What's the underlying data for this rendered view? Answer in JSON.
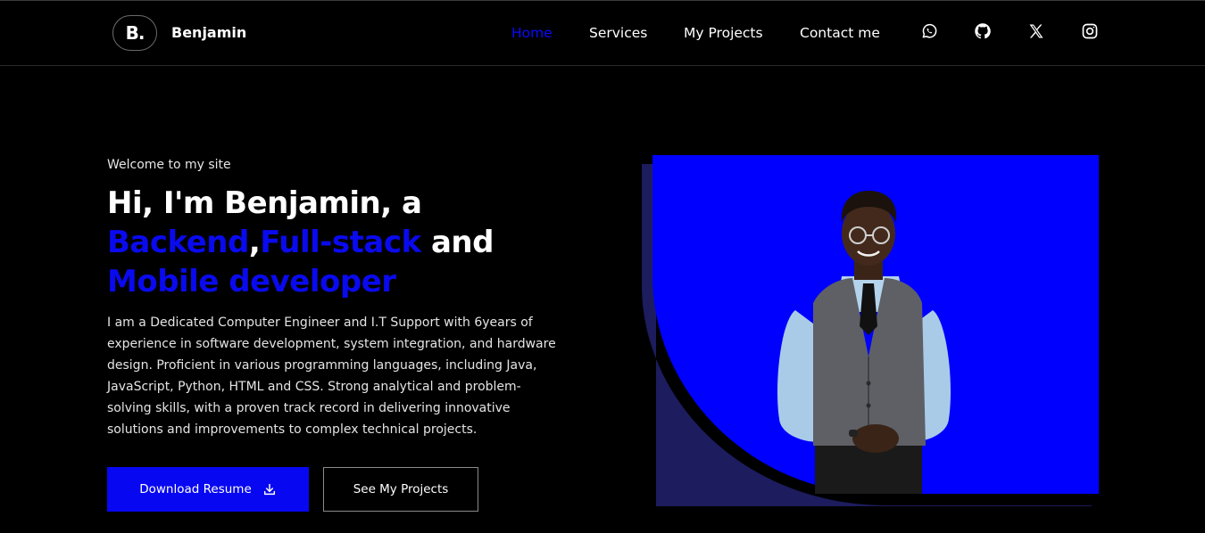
{
  "header": {
    "logo_text": "B.",
    "brand_name": "Benjamin",
    "nav": [
      {
        "label": "Home",
        "active": true
      },
      {
        "label": "Services",
        "active": false
      },
      {
        "label": "My Projects",
        "active": false
      },
      {
        "label": "Contact me",
        "active": false
      }
    ],
    "social_icons": [
      "whatsapp-icon",
      "github-icon",
      "x-icon",
      "instagram-icon"
    ]
  },
  "hero": {
    "welcome": "Welcome to my site",
    "headline": {
      "line1": "Hi, I'm Benjamin, a",
      "backend": "Backend",
      "comma": ",",
      "fullstack": "Full-stack",
      "and": " and",
      "mobile": "Mobile developer"
    },
    "description": "I am a Dedicated Computer Engineer and I.T Support with 6years of experience in software development, system integration, and hardware design. Proficient in various programming languages, including Java, JavaScript, Python, HTML and CSS. Strong analytical and problem-solving skills, with a proven track record in delivering innovative solutions and improvements to complex technical projects.",
    "buttons": {
      "download_resume": "Download Resume",
      "see_projects": "See My Projects"
    },
    "image": {
      "subject": "portrait-of-benjamin",
      "background_color": "#0000ff",
      "shadow_color": "#1c1c5e"
    }
  },
  "colors": {
    "accent": "#0a0aef",
    "background": "#000000",
    "text": "#ffffff"
  }
}
